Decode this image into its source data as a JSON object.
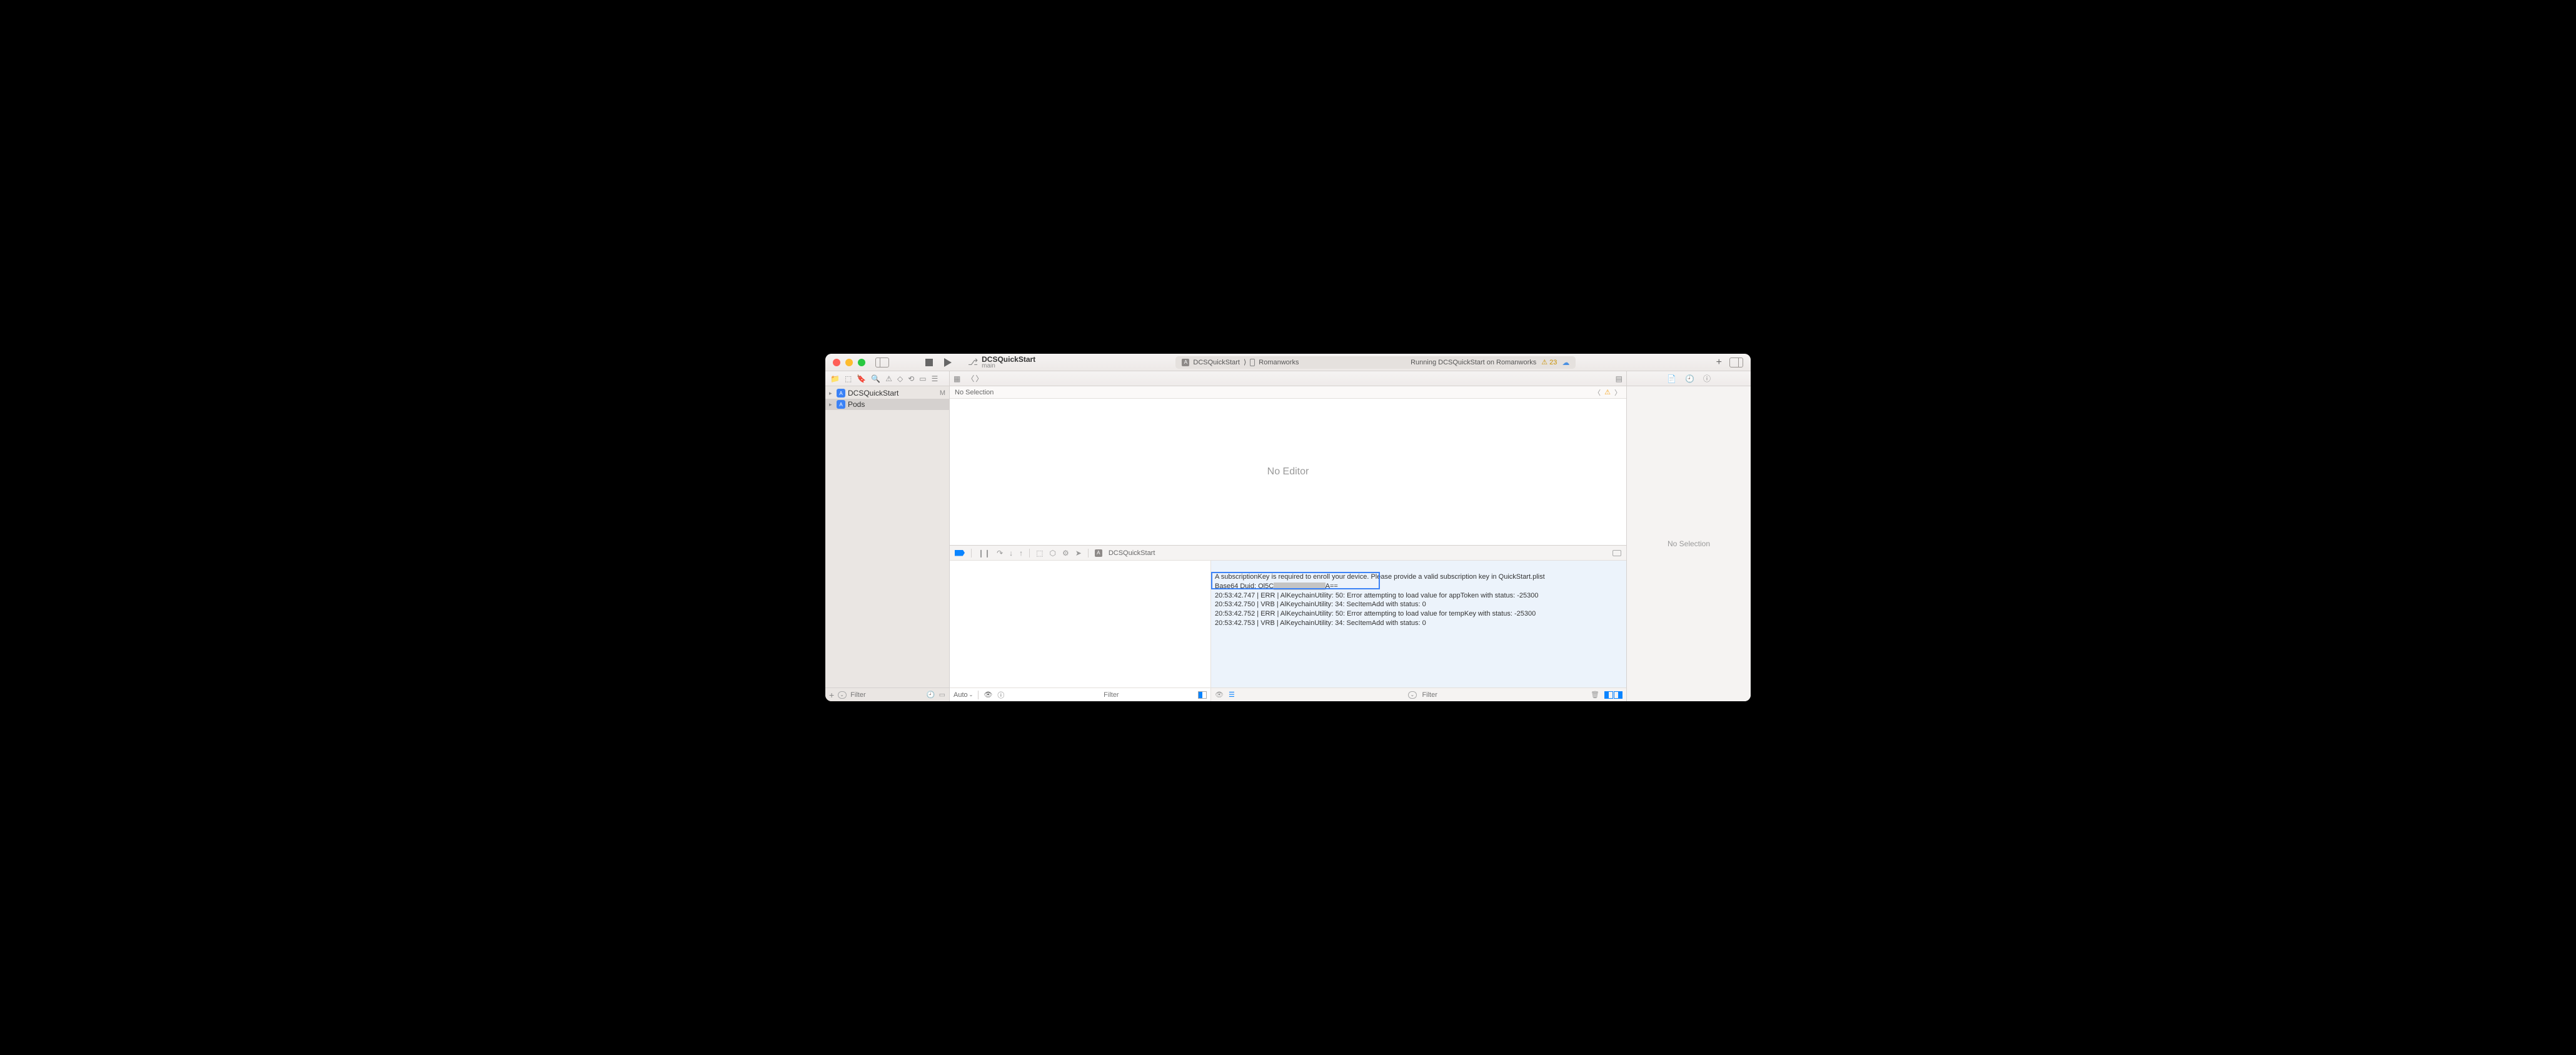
{
  "toolbar": {
    "project_name": "DCSQuickStart",
    "branch": "main",
    "scheme": "DCSQuickStart",
    "scheme_sep": "⟩",
    "destination": "Romanworks",
    "status_text": "Running DCSQuickStart on Romanworks",
    "warning_count": "⚠︎ 23"
  },
  "navigator": {
    "items": [
      {
        "label": "DCSQuickStart",
        "badge": "M",
        "selected": false
      },
      {
        "label": "Pods",
        "badge": "",
        "selected": true
      }
    ],
    "filter_placeholder": "Filter"
  },
  "jumpbar": {
    "text": "No Selection"
  },
  "editor": {
    "no_editor": "No Editor"
  },
  "debug": {
    "process": "DCSQuickStart",
    "vars_scope": "Auto",
    "vars_filter_placeholder": "Filter",
    "console_filter_placeholder": "Filter",
    "console_lines": [
      "A subscriptionKey is required to enroll your device. Please provide a valid subscription key in QuickStart.plist",
      "Base64 Duid: Ol5C███████████████A==",
      "20:53:42.747 | ERR | AlKeychainUtility: 50: Error attempting to load value for appToken with status: -25300",
      "20:53:42.750 | VRB | AlKeychainUtility: 34: SecItemAdd with status: 0",
      "20:53:42.752 | ERR | AlKeychainUtility: 50: Error attempting to load value for tempKey with status: -25300",
      "20:53:42.753 | VRB | AlKeychainUtility: 34: SecItemAdd with status: 0"
    ]
  },
  "inspector": {
    "empty_text": "No Selection"
  }
}
